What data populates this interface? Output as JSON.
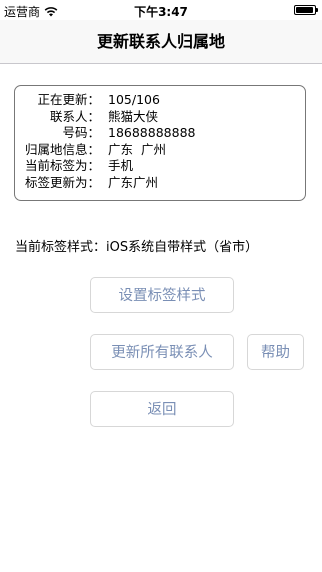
{
  "status_bar": {
    "carrier": "运营商",
    "time": "下午3:47",
    "battery_level": 0.95
  },
  "nav": {
    "title": "更新联系人归属地"
  },
  "info": {
    "rows": [
      {
        "label": "正在更新：",
        "value": "105/106"
      },
      {
        "label": "联系人：",
        "value": "熊猫大侠"
      },
      {
        "label": "号码：",
        "value": "18688888888"
      },
      {
        "label": "归属地信息：",
        "value": "广东  广州"
      },
      {
        "label": "当前标签为：",
        "value": "手机"
      },
      {
        "label": "标签更新为：",
        "value": "广东广州"
      }
    ]
  },
  "style_line": "当前标签样式：iOS系统自带样式（省市）",
  "buttons": {
    "set_label": "设置标签样式",
    "update_all": "更新所有联系人",
    "help": "帮助",
    "back": "返回"
  },
  "colors": {
    "button_text": "#7a8fb5",
    "button_border": "#d7d7d7",
    "nav_background": "#f8f8f8"
  },
  "icons": [
    "wifi-icon",
    "battery-icon"
  ]
}
